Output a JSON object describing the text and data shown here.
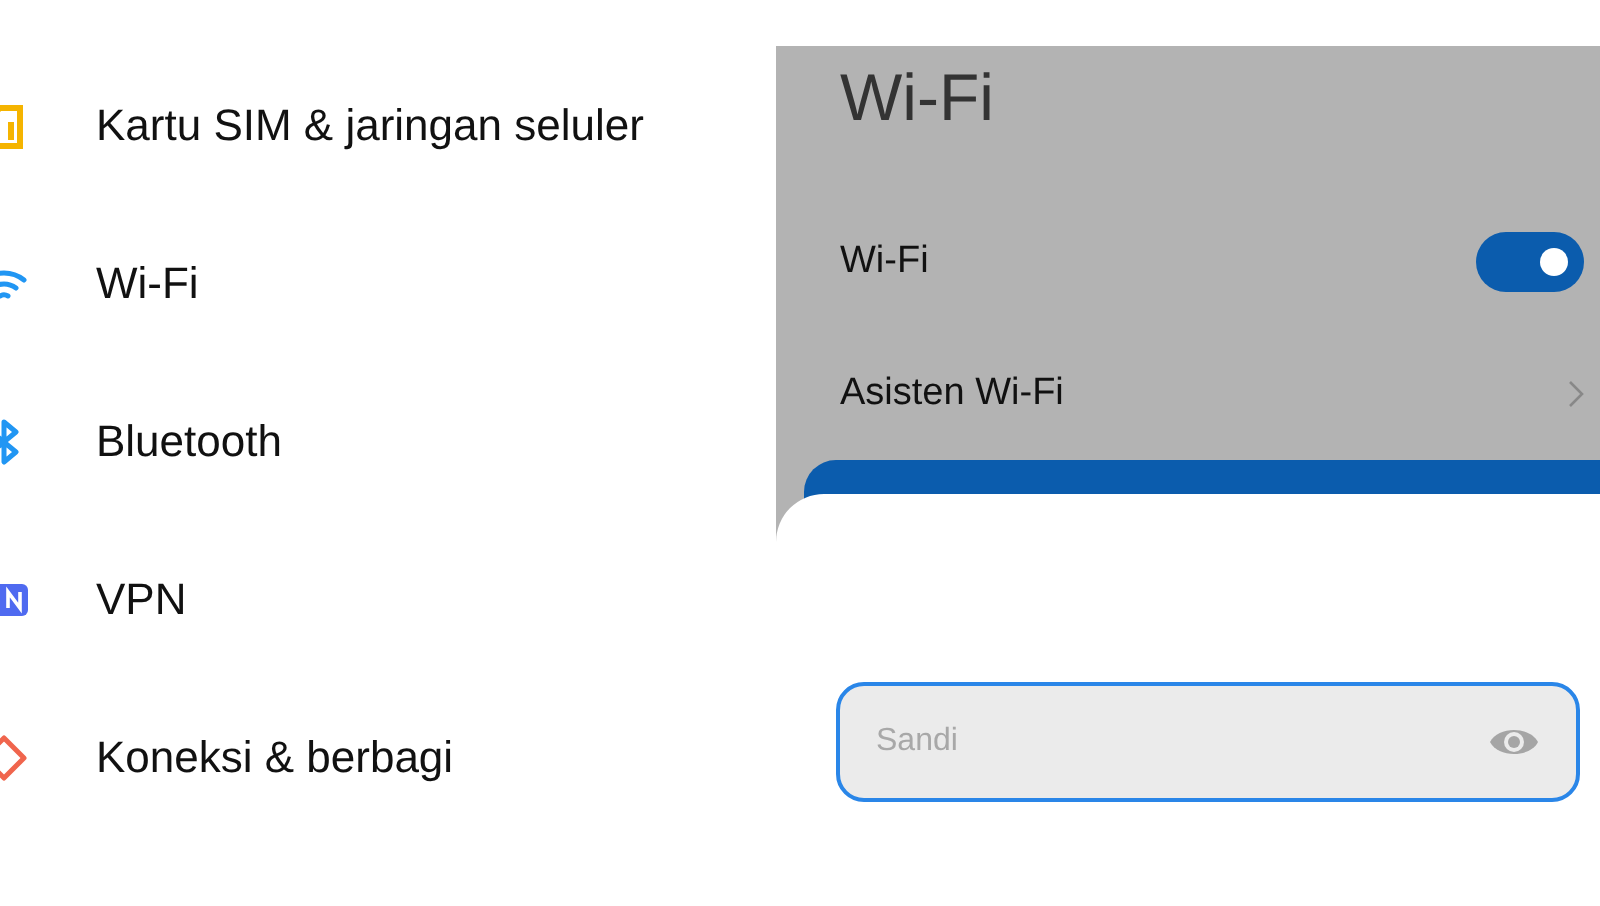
{
  "settings_list": [
    {
      "label": "Kartu SIM & jaringan seluler",
      "kind": "sim",
      "color": "#f5b400"
    },
    {
      "label": "Wi-Fi",
      "kind": "wifi",
      "color": "#2196f3"
    },
    {
      "label": "Bluetooth",
      "kind": "bluetooth",
      "color": "#2196f3"
    },
    {
      "label": "VPN",
      "kind": "vpn",
      "color": "#4f6af0"
    },
    {
      "label": "Koneksi & berbagi",
      "kind": "share",
      "color": "#f0654d"
    }
  ],
  "wifi_screen": {
    "title": "Wi-Fi",
    "rows": [
      {
        "kind": "toggle",
        "label": "Wi-Fi",
        "on": true
      },
      {
        "kind": "link",
        "label": "Asisten Wi-Fi"
      }
    ]
  },
  "password_dialog": {
    "password_field": {
      "placeholder": "Sandi"
    }
  }
}
